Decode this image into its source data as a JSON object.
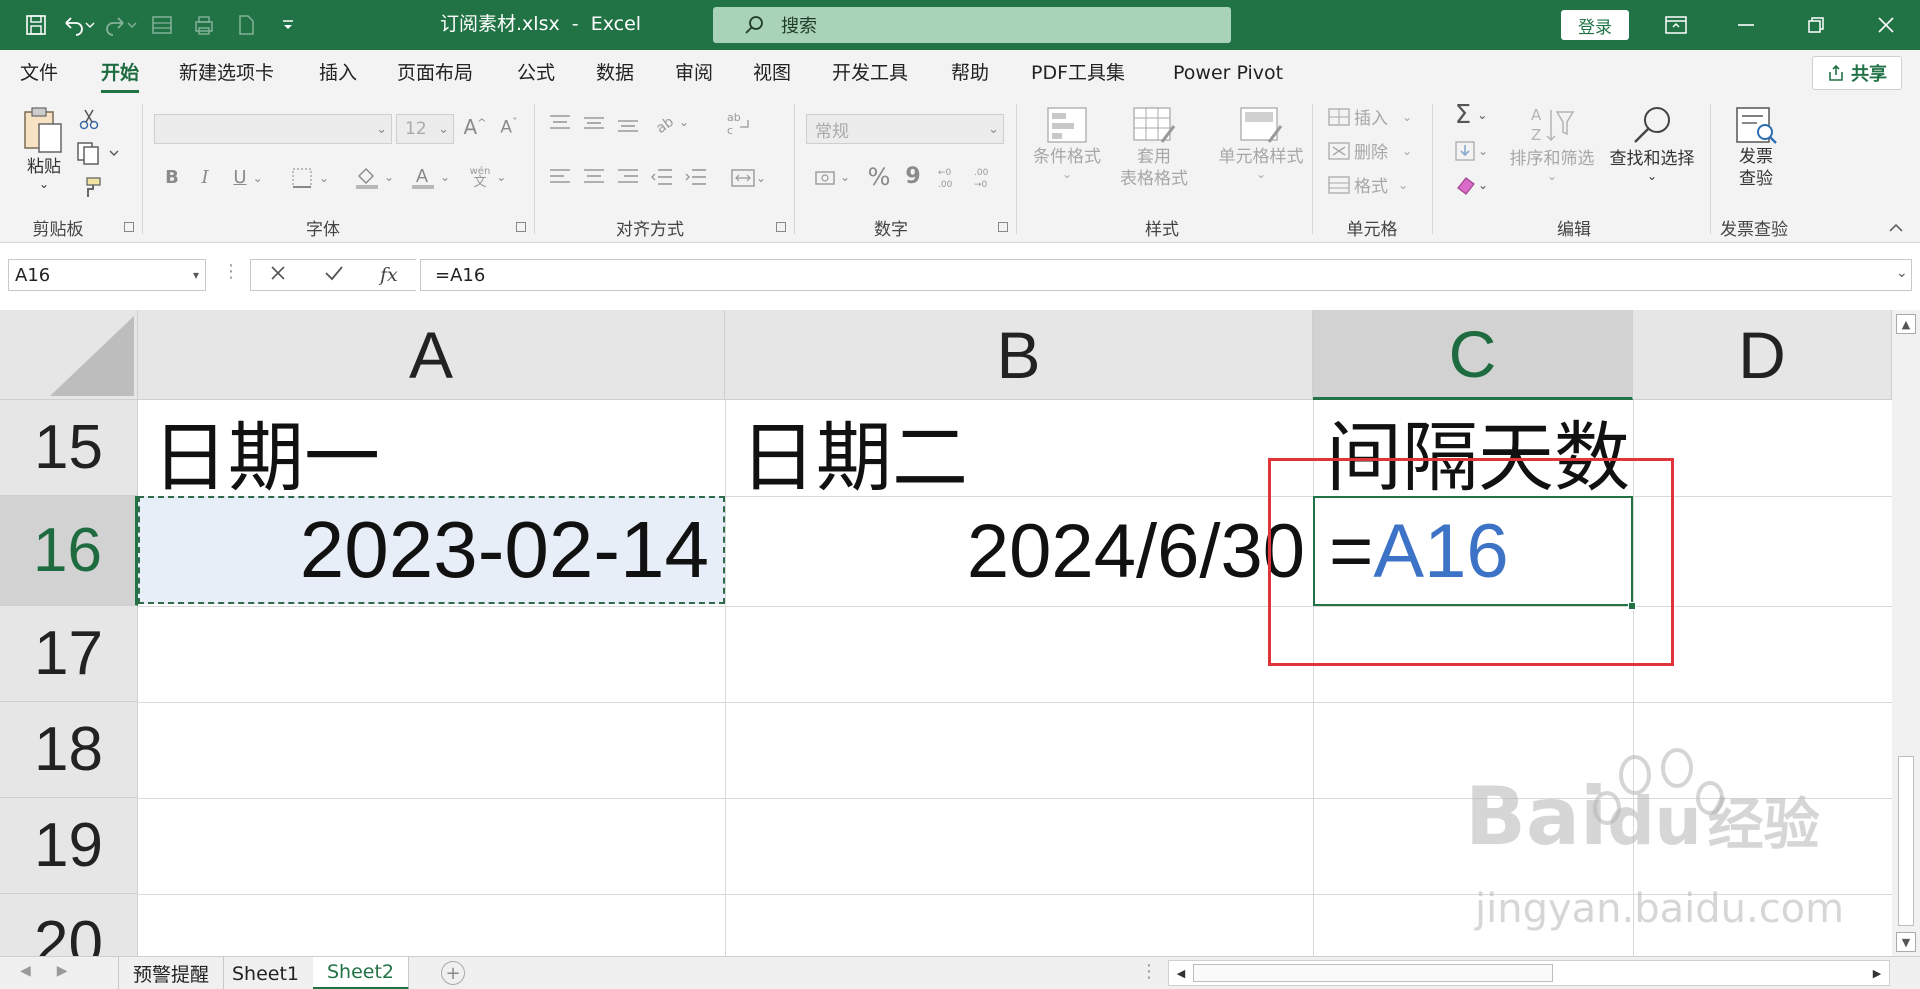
{
  "window": {
    "title": "订阅素材.xlsx  -  Excel",
    "search_placeholder": "搜索",
    "login_label": "登录",
    "share_label": "共享"
  },
  "tabs": [
    "文件",
    "开始",
    "新建选项卡",
    "插入",
    "页面布局",
    "公式",
    "数据",
    "审阅",
    "视图",
    "开发工具",
    "帮助",
    "PDF工具集",
    "Power Pivot"
  ],
  "active_tab": "开始",
  "ribbon": {
    "groups": [
      "剪贴板",
      "字体",
      "对齐方式",
      "数字",
      "样式",
      "单元格",
      "编辑",
      "发票查验"
    ],
    "clipboard": {
      "paste": "粘贴"
    },
    "font": {
      "font_name": "",
      "font_size": "12",
      "wen": "wén",
      "wen2": "文"
    },
    "number": {
      "format": "常规",
      "percent": "%",
      "comma": "9"
    },
    "styles": {
      "conditional": "条件格式",
      "table_line1": "套用",
      "table_line2": "表格格式",
      "cell_styles": "单元格样式"
    },
    "cells": {
      "insert": "插入",
      "delete": "删除",
      "format": "格式"
    },
    "editing": {
      "sort_filter": "排序和筛选",
      "find_select": "查找和选择"
    },
    "invoice": {
      "line1": "发票",
      "line2": "查验"
    }
  },
  "formula_bar": {
    "name_box": "A16",
    "formula": "=A16",
    "fx": "fx"
  },
  "grid": {
    "columns": [
      "A",
      "B",
      "C",
      "D"
    ],
    "selected_column": "C",
    "rows": [
      "15",
      "16",
      "17",
      "18",
      "19",
      "20"
    ],
    "selected_row": "16",
    "cells": {
      "A15": "日期一",
      "B15": "日期二",
      "C15": "间隔天数",
      "A16": "2023-02-14",
      "B16": "2024/6/30",
      "C16_eq": "=",
      "C16_ref": "A16"
    }
  },
  "sheets": [
    "预警提醒",
    "Sheet1",
    "Sheet2"
  ],
  "active_sheet": "Sheet2",
  "watermark": {
    "brand": "Bai",
    "brand2": "du",
    "cn": "经验",
    "url": "jingyan.baidu.com"
  },
  "colors": {
    "excel_green": "#217346",
    "reference_blue": "#3c73c6",
    "highlight_red": "#e0333a",
    "copy_fill": "#e8eef8"
  }
}
